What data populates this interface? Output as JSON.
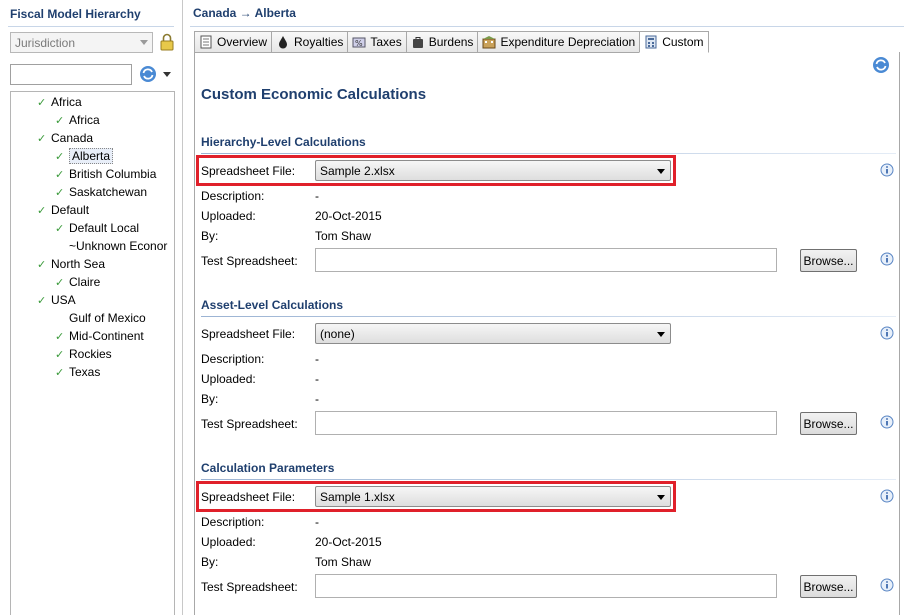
{
  "left": {
    "title": "Fiscal Model Hierarchy",
    "jurisdiction_value": "Jurisdiction",
    "filter_placeholder": "",
    "tree": [
      {
        "label": "Africa",
        "checked": true,
        "level": 0
      },
      {
        "label": "Africa",
        "checked": true,
        "level": 1
      },
      {
        "label": "Canada",
        "checked": true,
        "level": 0
      },
      {
        "label": "Alberta",
        "checked": true,
        "level": 1,
        "selected": true
      },
      {
        "label": "British Columbia",
        "checked": true,
        "level": 1
      },
      {
        "label": "Saskatchewan",
        "checked": true,
        "level": 1
      },
      {
        "label": "Default",
        "checked": true,
        "level": 0
      },
      {
        "label": "Default Local",
        "checked": true,
        "level": 1
      },
      {
        "label": "~Unknown Econor",
        "checked": false,
        "level": 1
      },
      {
        "label": "North Sea",
        "checked": true,
        "level": 0
      },
      {
        "label": "Claire",
        "checked": true,
        "level": 1
      },
      {
        "label": "USA",
        "checked": true,
        "level": 0
      },
      {
        "label": "Gulf of Mexico",
        "checked": false,
        "level": 1
      },
      {
        "label": "Mid-Continent",
        "checked": true,
        "level": 1
      },
      {
        "label": "Rockies",
        "checked": true,
        "level": 1
      },
      {
        "label": "Texas",
        "checked": true,
        "level": 1
      }
    ]
  },
  "right": {
    "breadcrumb": "Canada → Alberta",
    "tabs": [
      {
        "label": "Overview",
        "icon": "document-icon"
      },
      {
        "label": "Royalties",
        "icon": "oil-drop-icon"
      },
      {
        "label": "Taxes",
        "icon": "tax-icon"
      },
      {
        "label": "Burdens",
        "icon": "bag-icon"
      },
      {
        "label": "Expenditure Depreciation",
        "icon": "building-icon"
      },
      {
        "label": "Custom",
        "icon": "calculator-icon",
        "active": true
      }
    ],
    "page_title": "Custom Economic Calculations",
    "sections": [
      {
        "title": "Hierarchy-Level Calculations",
        "spreadsheet_label": "Spreadsheet File:",
        "spreadsheet_value": "Sample 2.xlsx",
        "description_label": "Description:",
        "description_value": "-",
        "uploaded_label": "Uploaded:",
        "uploaded_value": "20-Oct-2015",
        "by_label": "By:",
        "by_value": "Tom Shaw",
        "test_label": "Test Spreadsheet:",
        "browse_label": "Browse...",
        "highlighted": true
      },
      {
        "title": "Asset-Level Calculations",
        "spreadsheet_label": "Spreadsheet File:",
        "spreadsheet_value": "(none)",
        "description_label": "Description:",
        "description_value": "-",
        "uploaded_label": "Uploaded:",
        "uploaded_value": "-",
        "by_label": "By:",
        "by_value": "-",
        "test_label": "Test Spreadsheet:",
        "browse_label": "Browse...",
        "highlighted": false
      },
      {
        "title": "Calculation Parameters",
        "spreadsheet_label": "Spreadsheet File:",
        "spreadsheet_value": "Sample 1.xlsx",
        "description_label": "Description:",
        "description_value": "-",
        "uploaded_label": "Uploaded:",
        "uploaded_value": "20-Oct-2015",
        "by_label": "By:",
        "by_value": "Tom Shaw",
        "test_label": "Test Spreadsheet:",
        "browse_label": "Browse...",
        "highlighted": true
      }
    ]
  },
  "colors": {
    "heading": "#1f3f6e",
    "highlight": "#e0202a",
    "check": "#3a9a3a"
  }
}
